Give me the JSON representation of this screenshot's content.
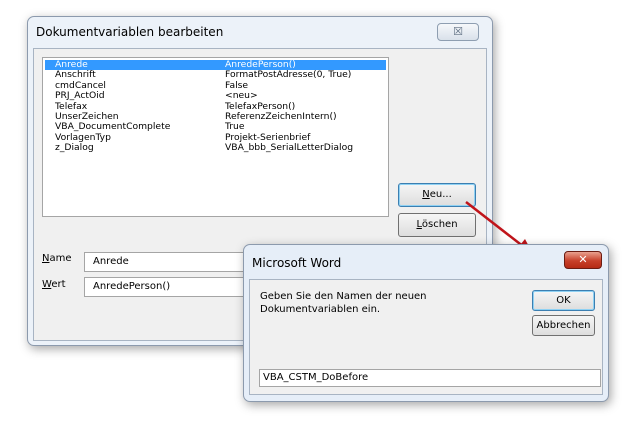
{
  "back_dialog": {
    "title": "Dokumentvariablen bearbeiten",
    "close_glyph": "☒",
    "variables": [
      {
        "name": "Anrede",
        "value": "AnredePerson()"
      },
      {
        "name": "Anschrift",
        "value": "FormatPostAdresse(0, True)"
      },
      {
        "name": "cmdCancel",
        "value": "False"
      },
      {
        "name": "PRJ_ActOid",
        "value": "<neu>"
      },
      {
        "name": "Telefax",
        "value": "TelefaxPerson()"
      },
      {
        "name": "UnserZeichen",
        "value": "ReferenzZeichenIntern()"
      },
      {
        "name": "VBA_DocumentComplete",
        "value": "True"
      },
      {
        "name": "VorlagenTyp",
        "value": "Projekt-Serienbrief"
      },
      {
        "name": "z_Dialog",
        "value": "VBA_bbb_SerialLetterDialog"
      }
    ],
    "selected_index": 0,
    "new_button": {
      "mnemonic": "N",
      "rest": "eu..."
    },
    "delete_button": {
      "mnemonic": "L",
      "rest": "öschen"
    },
    "name_label": {
      "mnemonic": "N",
      "rest": "ame"
    },
    "name_value": "Anrede",
    "value_label": {
      "mnemonic": "W",
      "rest": "ert"
    },
    "value_value": "AnredePerson()"
  },
  "front_dialog": {
    "title": "Microsoft Word",
    "close_glyph": "✕",
    "prompt": "Geben Sie den Namen der neuen Dokumentvariablen ein.",
    "ok_label": "OK",
    "cancel_label": "Abbrechen",
    "input_value": "VBA_CSTM_DoBefore"
  },
  "colors": {
    "arrow": "#c0141a",
    "selection": "#3399ff"
  }
}
